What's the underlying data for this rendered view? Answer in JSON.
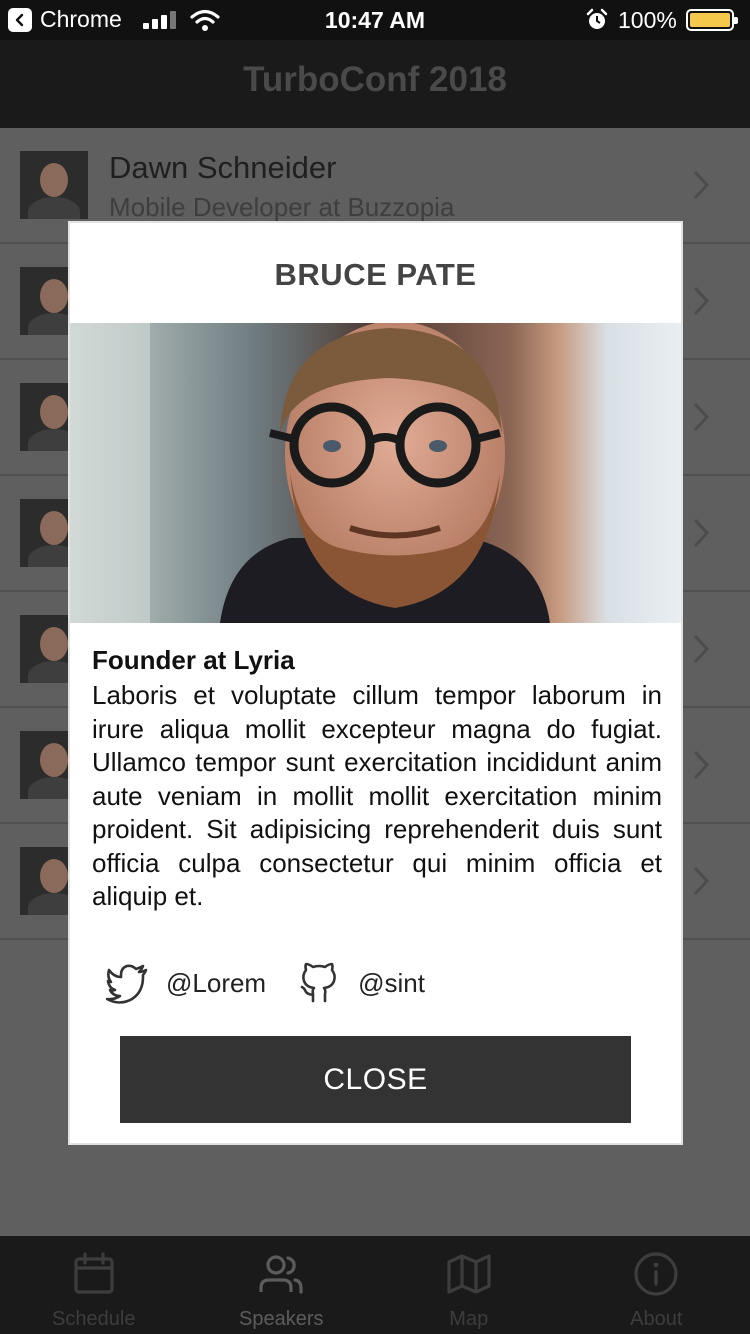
{
  "status_bar": {
    "back_app": "Chrome",
    "time": "10:47 AM",
    "battery": "100%"
  },
  "header": {
    "title": "TurboConf 2018"
  },
  "speakers": [
    {
      "name": "Dawn Schneider",
      "role": "Mobile Developer at Buzzopia"
    },
    {
      "name": "",
      "role": ""
    },
    {
      "name": "",
      "role": ""
    },
    {
      "name": "",
      "role": ""
    },
    {
      "name": "",
      "role": ""
    },
    {
      "name": "",
      "role": ""
    },
    {
      "name": "",
      "role": ""
    }
  ],
  "modal": {
    "name": "BRUCE PATE",
    "role": "Founder at Lyria",
    "bio": "Laboris et voluptate cillum tempor laborum in irure aliqua mollit excepteur magna do fugiat. Ullamco tempor sunt exercitation incididunt anim aute veniam in mollit mollit exercitation minim proident. Sit adipisicing reprehenderit duis sunt officia culpa consectetur qui minim officia et aliquip et.",
    "twitter": "@Lorem",
    "github": "@sint",
    "close_label": "CLOSE"
  },
  "tabs": [
    {
      "label": "Schedule",
      "icon": "calendar-icon",
      "active": false
    },
    {
      "label": "Speakers",
      "icon": "people-icon",
      "active": true
    },
    {
      "label": "Map",
      "icon": "map-icon",
      "active": false
    },
    {
      "label": "About",
      "icon": "info-icon",
      "active": false
    }
  ],
  "colors": {
    "overlay": "#5f5f5f",
    "header": "#1a1a1a",
    "close_button": "#333333",
    "battery": "#f4c84a"
  }
}
